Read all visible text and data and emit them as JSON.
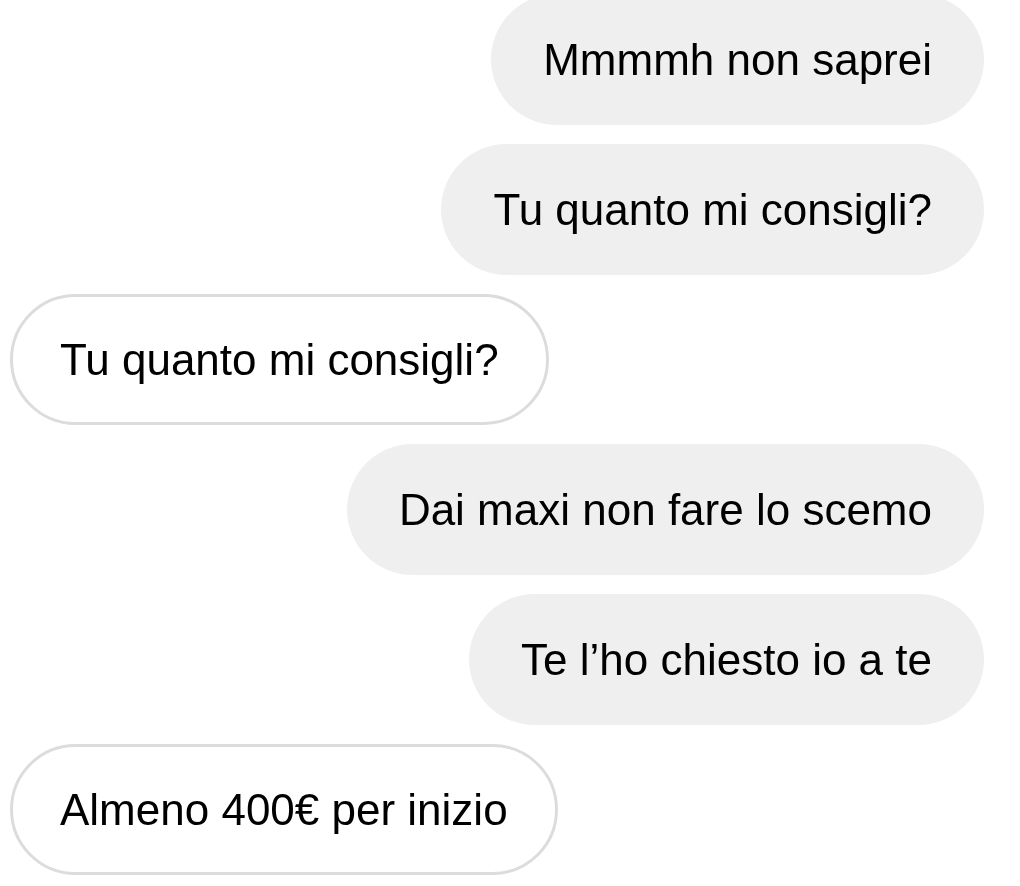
{
  "messages": [
    {
      "kind": "sent",
      "text": "Mmmmh non saprei"
    },
    {
      "kind": "sent",
      "text": "Tu quanto mi consigli?"
    },
    {
      "kind": "received",
      "text": "Tu quanto mi consigli?"
    },
    {
      "kind": "sent",
      "text": "Dai maxi non fare lo scemo"
    },
    {
      "kind": "sent",
      "text": "Te l’ho chiesto io a te"
    },
    {
      "kind": "received",
      "text": "Almeno 400€ per inizio"
    }
  ]
}
